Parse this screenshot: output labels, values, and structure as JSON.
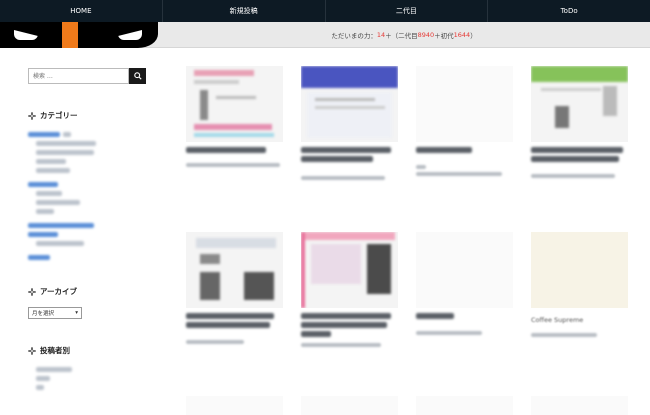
{
  "nav": {
    "items": [
      "HOME",
      "新規投稿",
      "二代目",
      "ToDo"
    ]
  },
  "banner": {
    "status_prefix": "ただいまの力：",
    "status_value": "14",
    "status_mid": "＋（二代目",
    "status_value2": "8940",
    "status_mid2": "＋初代",
    "status_value3": "1644",
    "status_suffix": "）"
  },
  "sidebar": {
    "search_placeholder": "検索 …",
    "categories_title": "カテゴリー",
    "archive_title": "アーカイブ",
    "archive_select": "月を選択",
    "authors_title": "投稿者別"
  },
  "cards": [
    {
      "title": "",
      "style": "pink"
    },
    {
      "title": "",
      "style": "blue-header"
    },
    {
      "title": "",
      "style": "white"
    },
    {
      "title": "",
      "style": "green-header"
    },
    {
      "title": "",
      "style": "gray-ui"
    },
    {
      "title": "",
      "style": "pink-ui"
    },
    {
      "title": "",
      "style": "white"
    },
    {
      "title": "Coffee Supreme",
      "style": "cream"
    }
  ],
  "colors": {
    "nav_bg": "#0d1a24",
    "accent_orange": "#f07a1a",
    "status_red": "#e53935"
  }
}
